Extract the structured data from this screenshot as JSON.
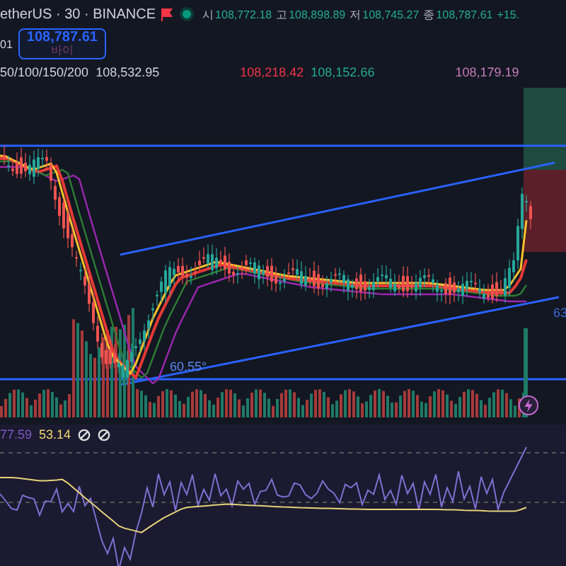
{
  "header": {
    "symbol": "etherUS · 30 · BINANCE",
    "quotes": [
      {
        "label": "시",
        "value": "108,772.18"
      },
      {
        "label": "고",
        "value": "108,898.89"
      },
      {
        "label": "저",
        "value": "108,745.27"
      },
      {
        "label": "종",
        "value": "108,787.61"
      }
    ],
    "change": "+15."
  },
  "order": {
    "side_label": "01",
    "price": "108,787.61",
    "action": "바이"
  },
  "ma": {
    "label": "50/100/150/200",
    "values": [
      {
        "value": "108,532.95",
        "color": "#d1d4dc"
      },
      {
        "value": "108,218.42",
        "color": "#f23645"
      },
      {
        "value": "108,152.66",
        "color": "#22ab94"
      },
      {
        "value": "108,179.19",
        "color": "#c77dbb"
      }
    ]
  },
  "angles": [
    "60.55°",
    "63"
  ],
  "rsi": {
    "values": [
      {
        "value": "77.59",
        "color": "#7e57c2"
      },
      {
        "value": "53.14",
        "color": "#f5d76e"
      }
    ]
  }
}
